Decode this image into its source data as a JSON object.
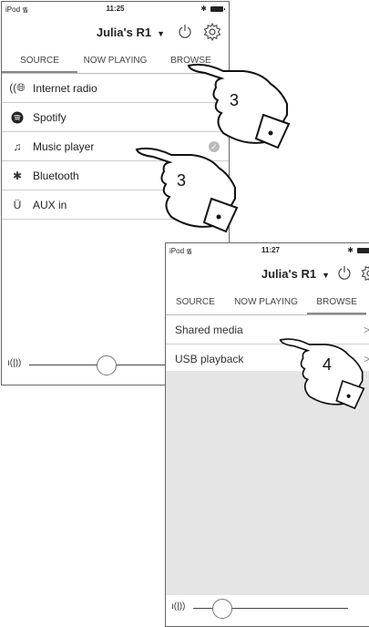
{
  "screen1": {
    "status": {
      "carrier": "iPod",
      "time": "11:25"
    },
    "header": {
      "device": "Julia's R1",
      "caret": "▼"
    },
    "tabs": [
      "SOURCE",
      "NOW PLAYING",
      "BROWSE"
    ],
    "items": [
      {
        "label": "Internet radio",
        "icon": "internet-radio-icon"
      },
      {
        "label": "Spotify",
        "icon": "spotify-icon"
      },
      {
        "label": "Music player",
        "icon": "music-note-icon",
        "selected": true
      },
      {
        "label": "Bluetooth",
        "icon": "bluetooth-icon"
      },
      {
        "label": "AUX in",
        "icon": "aux-cable-icon"
      }
    ],
    "volume_level": 0.4
  },
  "screen2": {
    "status": {
      "carrier": "iPod",
      "time": "11:27"
    },
    "header": {
      "device": "Julia's R1",
      "caret": "▼"
    },
    "tabs": [
      "SOURCE",
      "NOW PLAYING",
      "BROWSE"
    ],
    "items": [
      {
        "label": "Shared media"
      },
      {
        "label": "USB playback"
      }
    ],
    "volume_level": 0.18
  },
  "callouts": [
    {
      "number": "3",
      "target": "browse-tab"
    },
    {
      "number": "3",
      "target": "music-player"
    },
    {
      "number": "4",
      "target": "usb-playback"
    }
  ]
}
